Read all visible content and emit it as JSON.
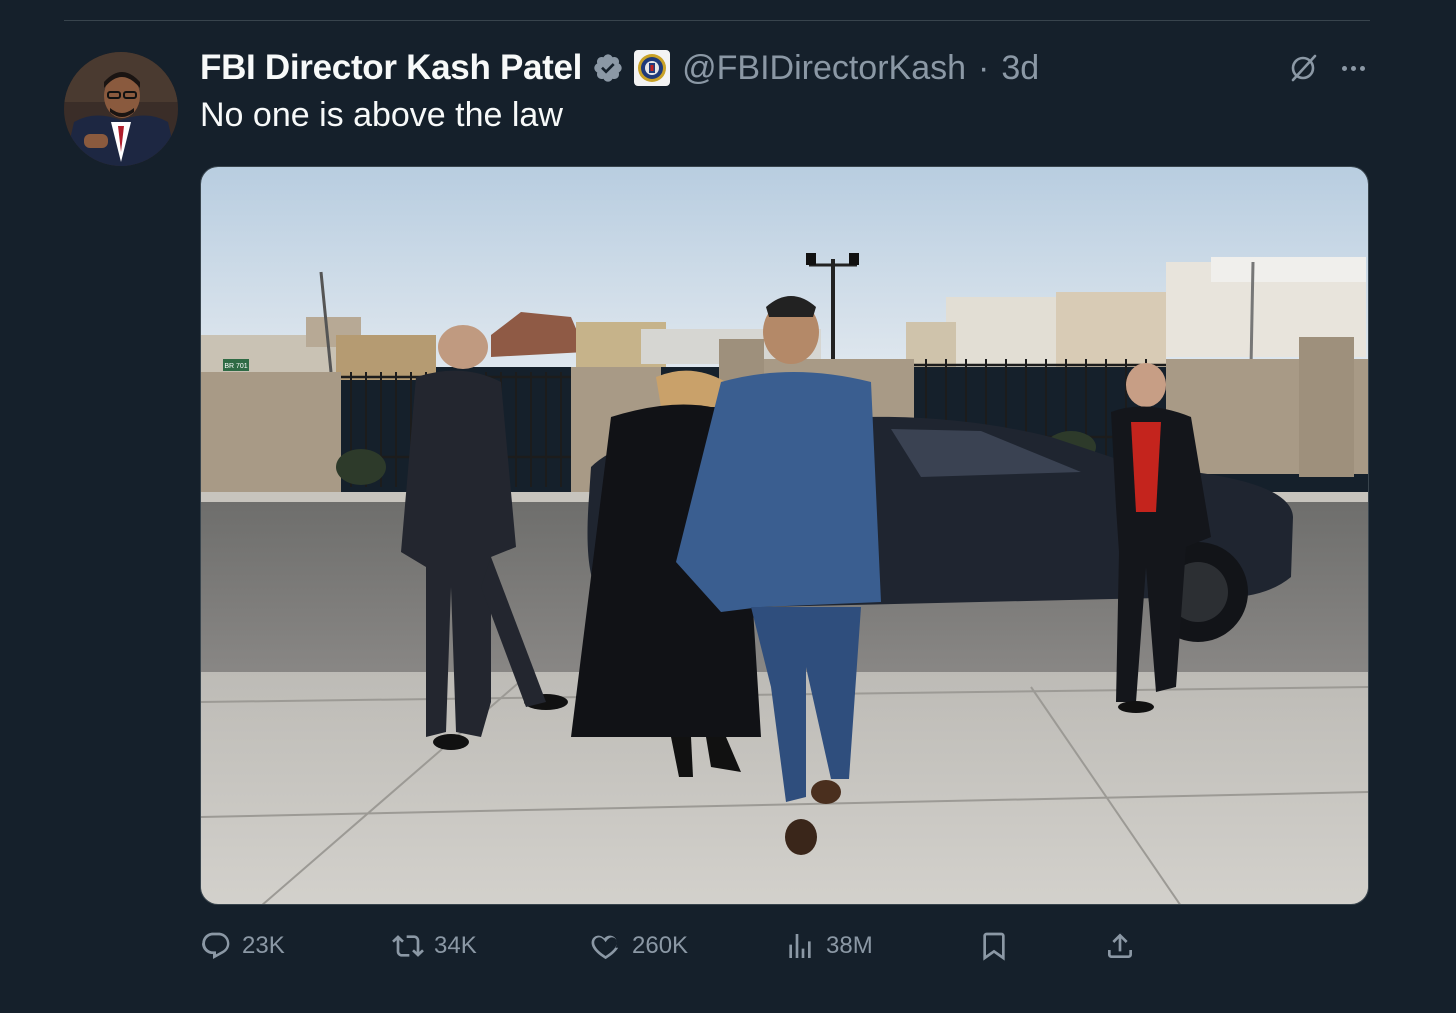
{
  "tweet": {
    "author_name": "FBI Director Kash Patel",
    "handle": "@FBIDirectorKash",
    "separator": "·",
    "time": "3d",
    "text": "No one is above the law"
  },
  "stats": {
    "replies": "23K",
    "reposts": "34K",
    "likes": "260K",
    "views": "38M"
  },
  "icons": {
    "verified": "verified-badge-icon",
    "affiliate": "fbi-seal-icon",
    "grok": "grok-icon",
    "more": "more-icon",
    "reply": "reply-icon",
    "repost": "repost-icon",
    "like": "heart-icon",
    "views": "views-icon",
    "bookmark": "bookmark-icon",
    "share": "share-icon"
  },
  "colors": {
    "background": "#15202b",
    "muted": "#8b98a5",
    "verified": "#8b98a5",
    "divider": "#38444d"
  },
  "media": {
    "street_sign": "BR 701"
  }
}
